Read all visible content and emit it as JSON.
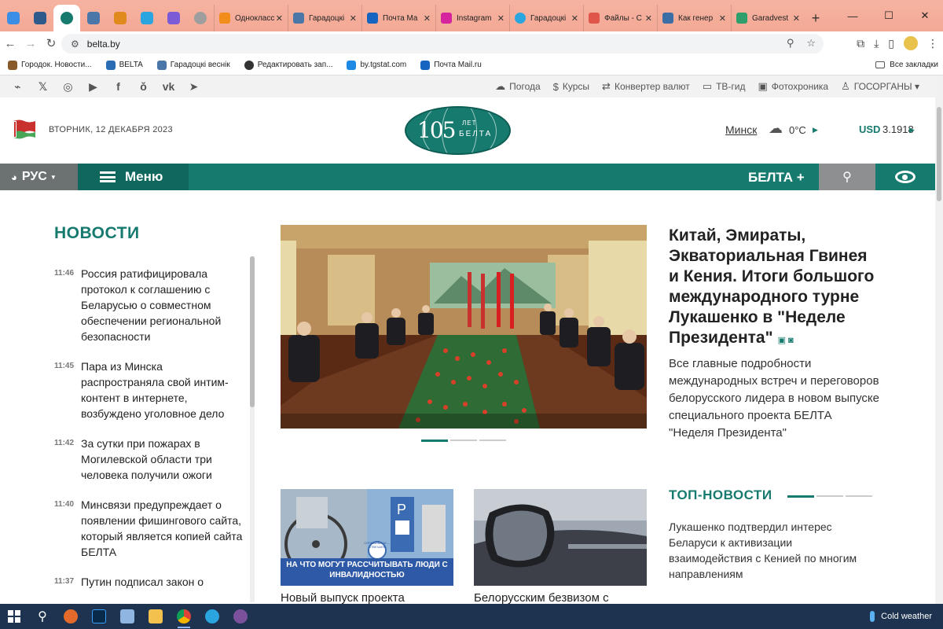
{
  "browser": {
    "tabs_small": [
      "tab-1",
      "tab-2",
      "tab-3-active",
      "tab-4",
      "tab-5",
      "tab-6",
      "tab-7",
      "tab-8"
    ],
    "tabs": [
      {
        "label": "Однокласс",
        "color": "#f28c1a"
      },
      {
        "label": "Гарадоцкі",
        "color": "#4a76a8"
      },
      {
        "label": "Почта Ma",
        "color": "#1565c0"
      },
      {
        "label": "Instagram",
        "color": "#d6249f"
      },
      {
        "label": "Гарадоцкі",
        "color": "#2aa5e0"
      },
      {
        "label": "Файлы - С",
        "color": "#e0554a"
      },
      {
        "label": "Как генер",
        "color": "#3a6ea5"
      },
      {
        "label": "Garadvest",
        "color": "#2e9e6a"
      }
    ],
    "url": "belta.by",
    "bookmarks": [
      {
        "label": "Городок. Новости...",
        "color": "#8b5a2b"
      },
      {
        "label": "BELTA",
        "color": "#2a6db5"
      },
      {
        "label": "Гарадоцкі веснік",
        "color": "#4a76a8"
      },
      {
        "label": "Редактировать зап...",
        "color": "#333333"
      },
      {
        "label": "by.tgstat.com",
        "color": "#1e88e5"
      },
      {
        "label": "Почта Mail.ru",
        "color": "#1565c0"
      }
    ],
    "all_bookmarks": "Все закладки"
  },
  "site": {
    "services": [
      {
        "icon": "cloud-sun-icon",
        "label": "Погода"
      },
      {
        "icon": "currency-icon",
        "label": "Курсы"
      },
      {
        "icon": "converter-icon",
        "label": "Конвертер валют"
      },
      {
        "icon": "tv-icon",
        "label": "ТВ-гид"
      },
      {
        "icon": "photo-icon",
        "label": "Фотохроника"
      },
      {
        "icon": "user-icon",
        "label": "ГОСОРГАНЫ ▾"
      }
    ],
    "date": "ВТОРНИК, 12 ДЕКАБРЯ 2023",
    "logo": {
      "number": "105",
      "years": "ЛЕТ",
      "name": "БЕЛТА"
    },
    "city": "Минск",
    "temperature": "0°C",
    "currency": "USD",
    "currency_rate": "3.1918",
    "lang": "РУС",
    "menu": "Меню",
    "belta_plus": "БЕЛТА +",
    "accent_color": "#167a6e"
  },
  "news": {
    "heading": "НОВОСТИ",
    "items": [
      {
        "time": "11:46",
        "text": "Россия ратифицировала протокол к соглашению с Беларусью о совместном обеспечении региональной безопасности"
      },
      {
        "time": "11:45",
        "text": "Пара из Минска распространяла свой интим-контент в интернете, возбуждено уголовное дело"
      },
      {
        "time": "11:42",
        "text": "За сутки при пожарах в Могилевской области три человека получили ожоги"
      },
      {
        "time": "11:40",
        "text": "Минсвязи предупреждает о появлении фишингового сайта, который является копией сайта БЕЛТА"
      },
      {
        "time": "11:37",
        "text": "Путин подписал закон о"
      }
    ]
  },
  "lead": {
    "title": "Китай, Эмираты, Экваториальная Гвинея и Кения. Итоги большого международного турне Лукашенко в \"Неделе Президента\"",
    "subtitle": "Все главные подробности международных встреч и переговоров белорусского лидера в новом выпуске специального проекта БЕЛТА \"Неделя Президента\""
  },
  "cards": [
    {
      "overlay": "НА ЧТО МОГУТ РАССЧИТЫВАТЬ ЛЮДИ С ИНВАЛИДНОСТЬЮ",
      "badge": "СПРАШИВАЛИ — ОТВЕЧАЕМ",
      "caption": "Новый выпуск проекта"
    },
    {
      "caption": "Белорусским безвизом с"
    }
  ],
  "top_news": {
    "heading": "ТОП-НОВОСТИ",
    "text": "Лукашенко подтвердил интерес Беларуси к активизации взаимодействия с Кенией по многим направлениям"
  },
  "taskbar": {
    "weather": "Cold weather"
  }
}
